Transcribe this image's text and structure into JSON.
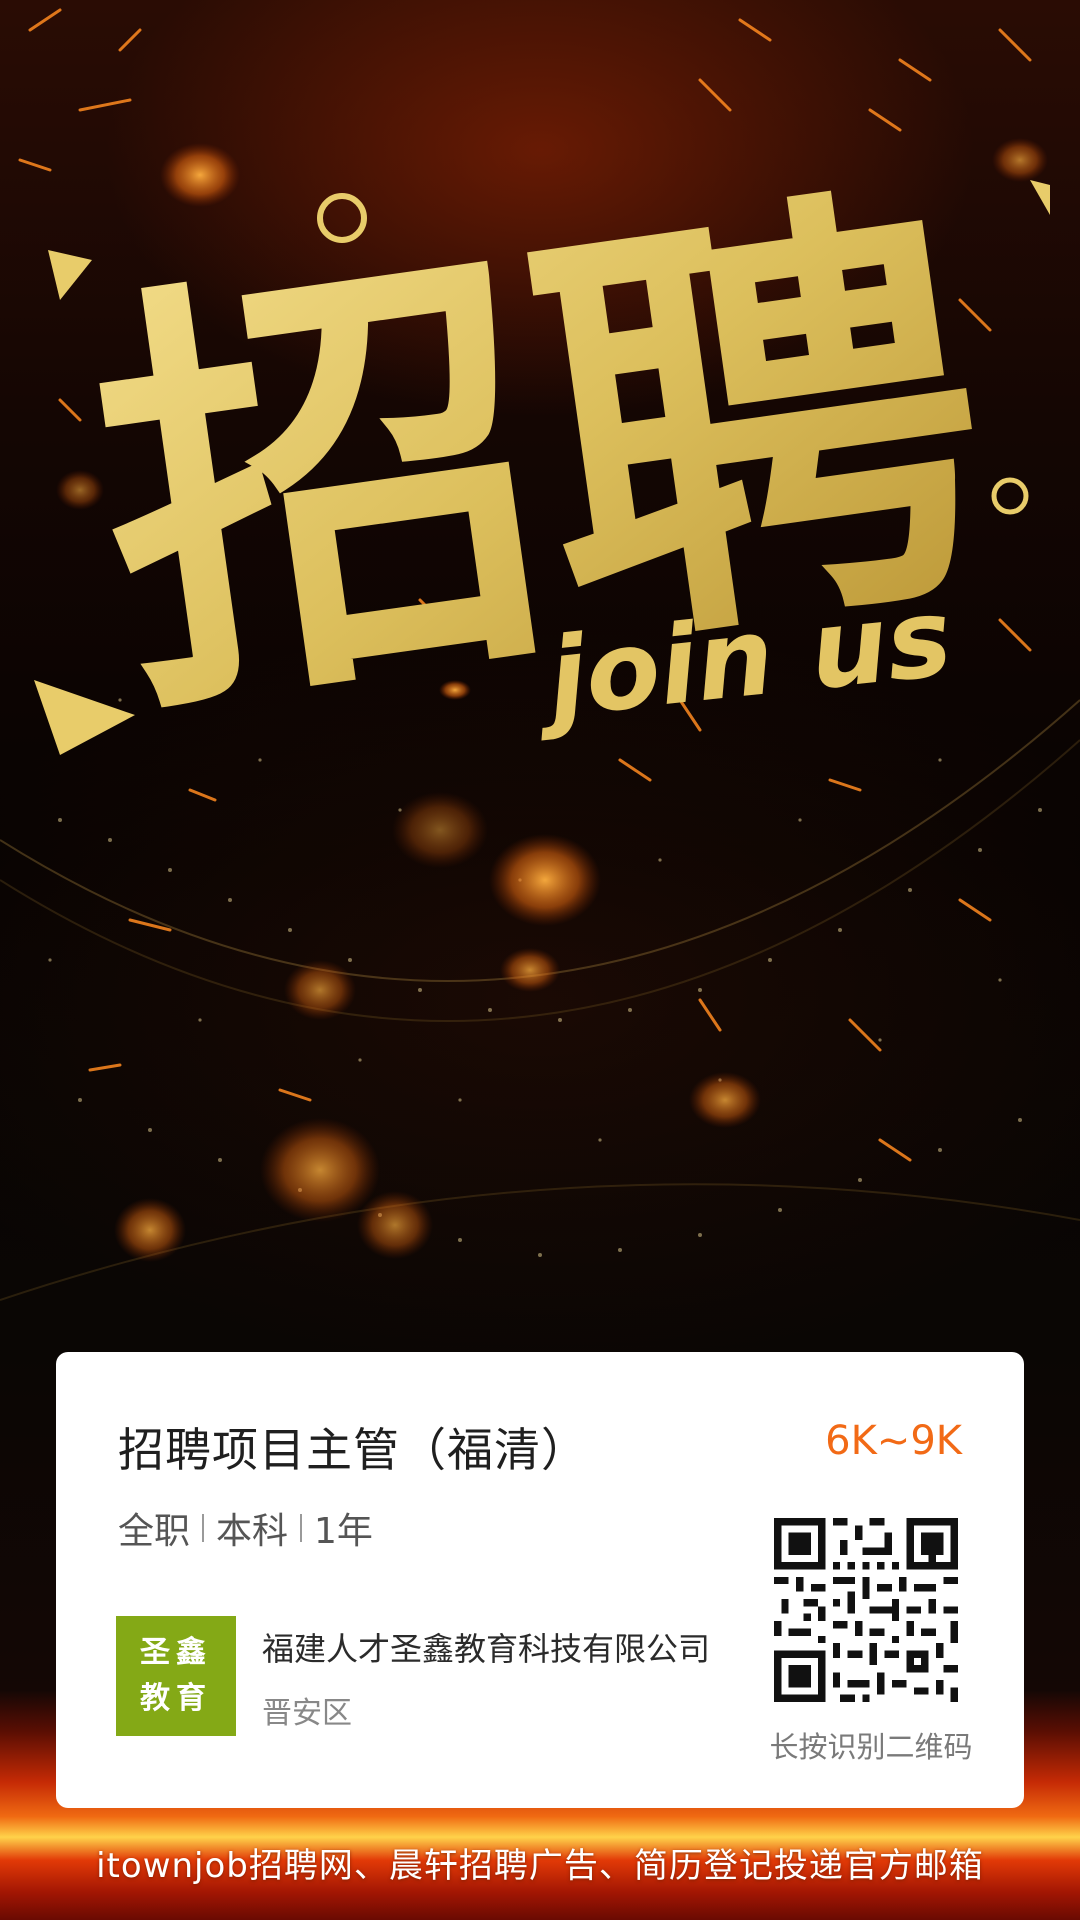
{
  "poster": {
    "headline": "招聘",
    "tagline": "join us"
  },
  "job": {
    "title": "招聘项目主管（福清）",
    "salary": "6K~9K",
    "type": "全职",
    "education": "本科",
    "experience": "1年"
  },
  "company": {
    "logo_line1": "圣鑫",
    "logo_line2": "教育",
    "name": "福建人才圣鑫教育科技有限公司",
    "area": "晋安区"
  },
  "qr": {
    "hint": "长按识别二维码"
  },
  "footer": {
    "text": "itownjob招聘网、晨轩招聘广告、简历登记投递官方邮箱"
  },
  "colors": {
    "gold": "#e8cc6a",
    "salary": "#f26a16",
    "logo_bg": "#84a916",
    "card_bg": "#ffffff"
  },
  "icons": {
    "qr": "qr-code-icon"
  }
}
